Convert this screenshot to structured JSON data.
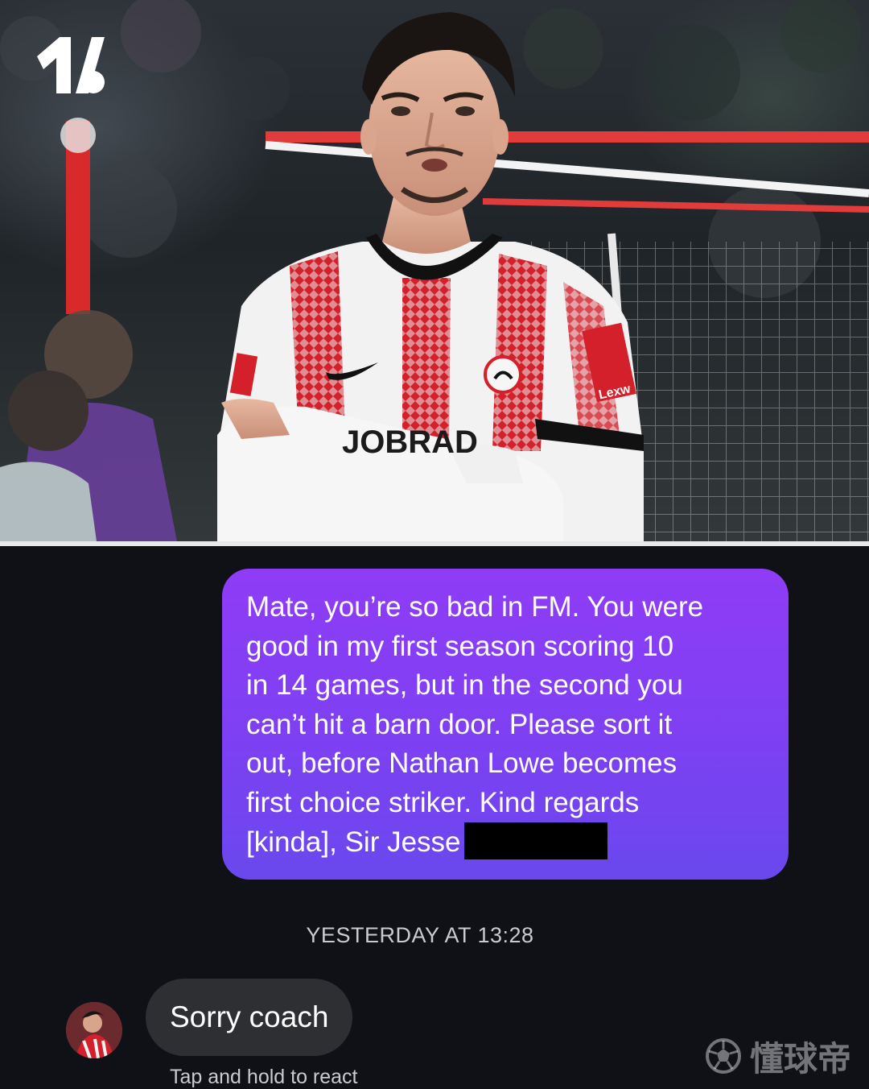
{
  "photo": {
    "brand_logo": "publisher-logo-icon",
    "shirt_sponsor_text": "JOBRAD",
    "sleeve_sponsor_text": "Lexw"
  },
  "messages": {
    "outgoing": {
      "lines": [
        "Mate, you’re so bad in FM. You were",
        "good in my first season scoring 10",
        "in 14 games, but in the second you",
        "can’t hit a barn door. Please sort it",
        "out, before Nathan Lowe becomes",
        "first choice striker. Kind regards",
        "[kinda], Sir Jesse"
      ],
      "redacted": true
    },
    "timestamp": "YESTERDAY AT 13:28",
    "incoming": {
      "text": "Sorry coach",
      "hint": "Tap and hold to react"
    }
  },
  "watermark": {
    "text": "懂球帝",
    "icon": "soccer-ball-icon"
  },
  "colors": {
    "bubble_start": "#8f3cf6",
    "bubble_end": "#6a48ee",
    "incoming_bubble": "#2d2f33",
    "background": "#0f1116",
    "jersey_red": "#d3202a"
  }
}
